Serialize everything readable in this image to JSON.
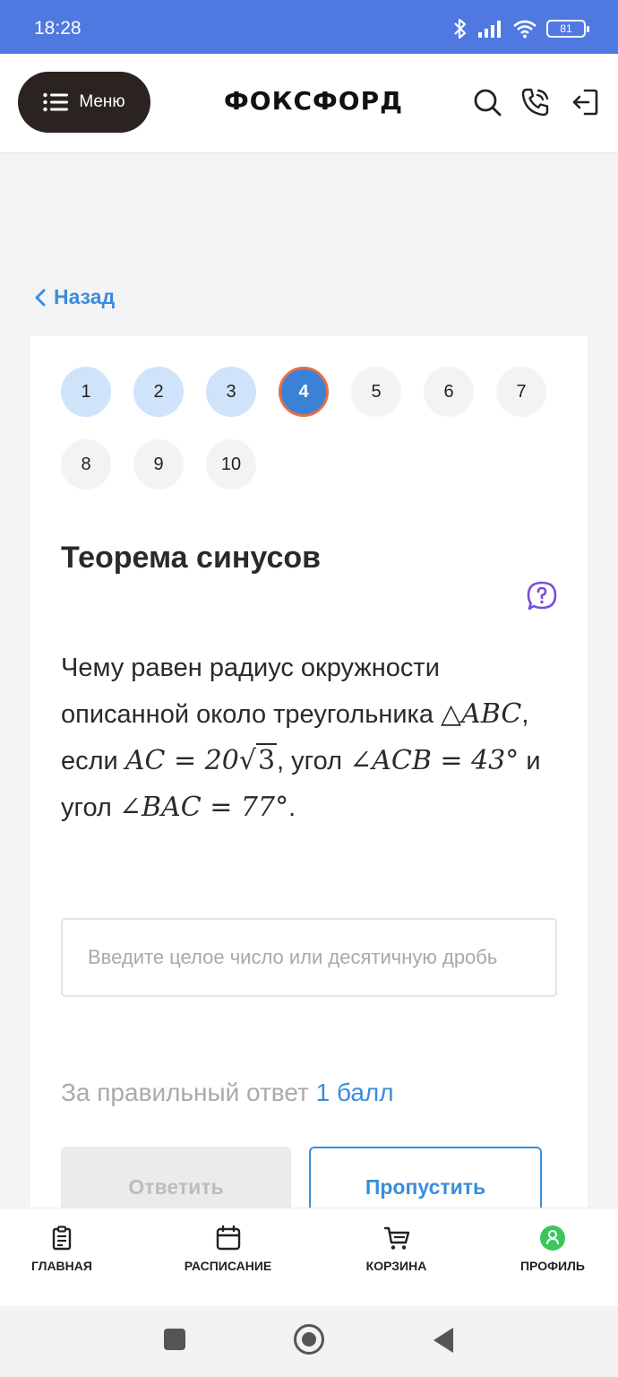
{
  "status_bar": {
    "time": "18:28",
    "battery": "81"
  },
  "header": {
    "menu_label": "Меню",
    "logo": "ФОКСФОРД"
  },
  "back_label": "Назад",
  "pager": {
    "items": [
      {
        "label": "1",
        "state": "done"
      },
      {
        "label": "2",
        "state": "done"
      },
      {
        "label": "3",
        "state": "done"
      },
      {
        "label": "4",
        "state": "active"
      },
      {
        "label": "5",
        "state": "todo"
      },
      {
        "label": "6",
        "state": "todo"
      },
      {
        "label": "7",
        "state": "todo"
      },
      {
        "label": "8",
        "state": "todo"
      },
      {
        "label": "9",
        "state": "todo"
      },
      {
        "label": "10",
        "state": "todo"
      }
    ]
  },
  "task": {
    "title": "Теорема синусов",
    "question_part1": "Чему равен радиус окружности описанной около треугольника ",
    "math_triangle": "△ABC",
    "question_part2": ", если ",
    "math_ac": "AC = 20",
    "math_sqrt": "3",
    "question_part3": ", угол ",
    "math_angle1": "∠ACB = 43°",
    "question_part4": " и угол ",
    "math_angle2": "∠BAC = 77°",
    "question_end": "."
  },
  "answer_input": {
    "placeholder": "Введите целое число или десятичную дробь"
  },
  "points": {
    "prefix": "За правильный ответ ",
    "value": "1 балл"
  },
  "buttons": {
    "answer": "Ответить",
    "skip": "Пропустить"
  },
  "bottom_nav": {
    "items": [
      {
        "label": "ГЛАВНАЯ",
        "icon": "clipboard-icon"
      },
      {
        "label": "РАСПИСАНИЕ",
        "icon": "calendar-icon"
      },
      {
        "label": "КОРЗИНА",
        "icon": "cart-icon"
      },
      {
        "label": "ПРОФИЛЬ",
        "icon": "profile-avatar-icon"
      }
    ]
  },
  "colors": {
    "status_bar": "#4f79e0",
    "accent_blue": "#3b8ddb",
    "active_pager": "#3b82d6",
    "active_ring": "#e2704a",
    "help_icon": "#7a4fd6",
    "profile_green": "#3cc55a"
  }
}
